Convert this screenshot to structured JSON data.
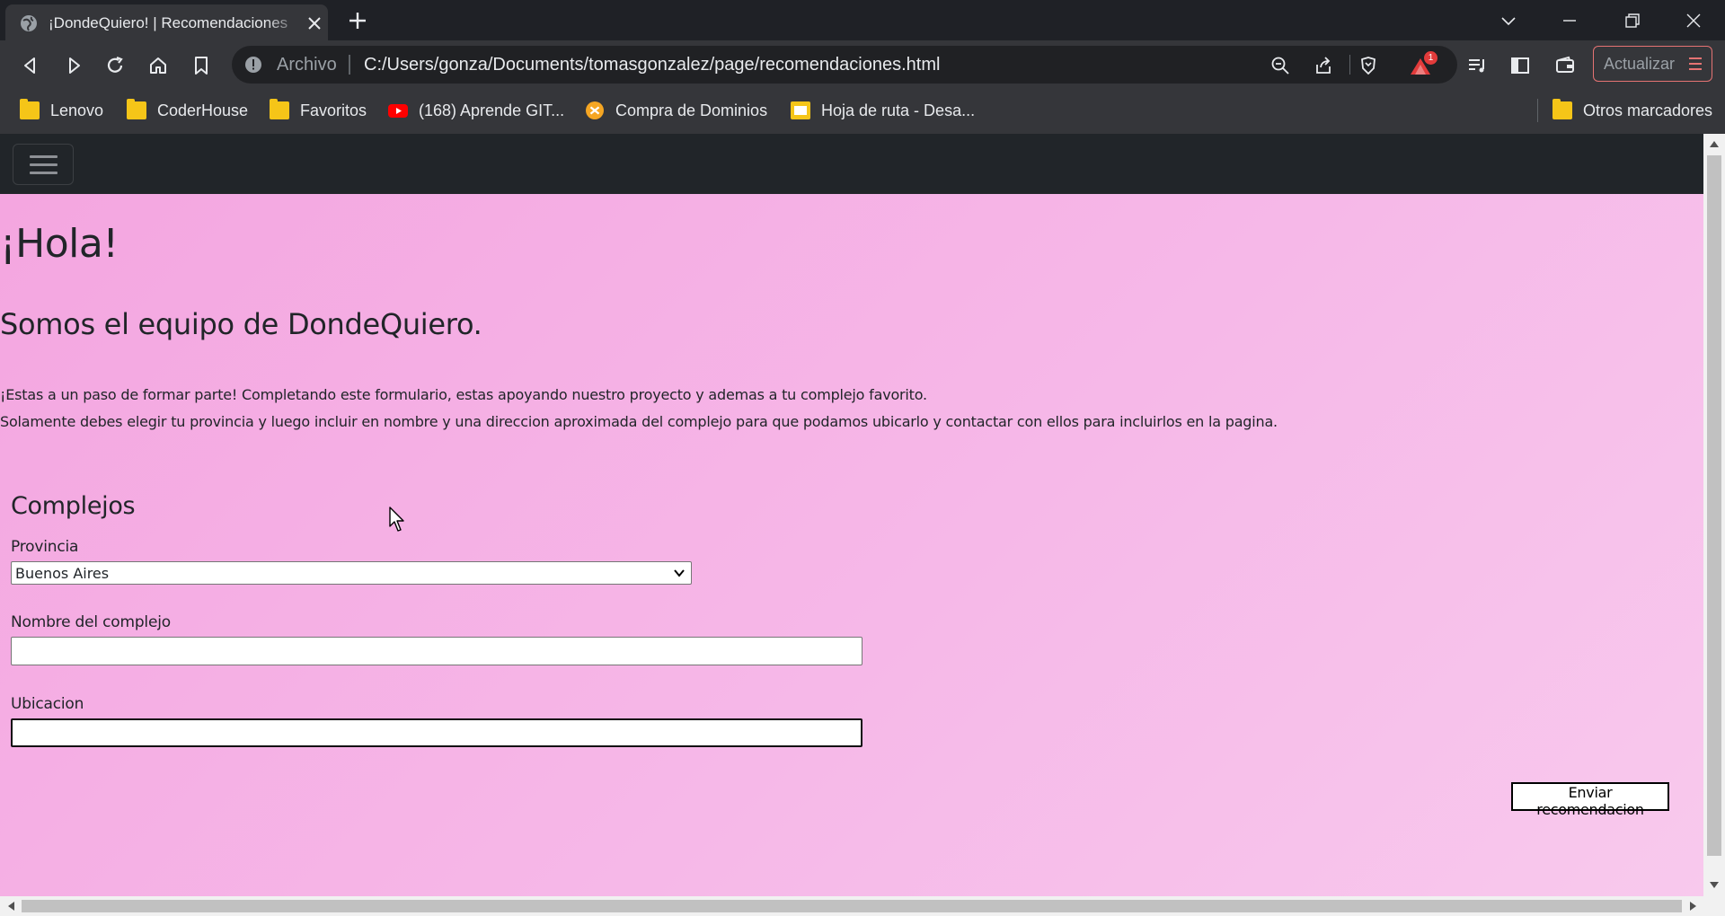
{
  "browser": {
    "tab": {
      "title": "¡DondeQuiero! | Recomendaciones",
      "icon": "globe-icon"
    },
    "address": {
      "scheme_label": "Archivo",
      "url": "C:/Users/gonza/Documents/tomasgonzalez/page/recomendaciones.html"
    },
    "update_button": "Actualizar",
    "rewards_badge": "1",
    "bookmarks": [
      {
        "label": "Lenovo",
        "icon": "folder-icon"
      },
      {
        "label": "CoderHouse",
        "icon": "folder-icon"
      },
      {
        "label": "Favoritos",
        "icon": "folder-icon"
      },
      {
        "label": "(168) Aprende GIT...",
        "icon": "youtube-icon"
      },
      {
        "label": "Compra de Dominios",
        "icon": "site-icon"
      },
      {
        "label": "Hoja de ruta - Desa...",
        "icon": "page-icon"
      }
    ],
    "other_bookmarks": "Otros marcadores"
  },
  "page": {
    "heading": "¡Hola!",
    "subheading": "Somos el equipo de DondeQuiero.",
    "intro_line1": "¡Estas a un paso de formar parte! Completando este formulario, estas apoyando nuestro proyecto y ademas a tu complejo favorito.",
    "intro_line2": "Solamente debes elegir tu provincia y luego incluir en nombre y una direccion aproximada del complejo para que podamos ubicarlo y contactar con ellos para incluirlos en la pagina.",
    "form": {
      "title": "Complejos",
      "province_label": "Provincia",
      "province_value": "Buenos Aires",
      "name_label": "Nombre del complejo",
      "name_value": "",
      "location_label": "Ubicacion",
      "location_value": "",
      "submit_label": "Enviar recomendacion"
    }
  },
  "colors": {
    "page_background": "#f6b8e8",
    "navbar": "#212529",
    "browser_chrome": "#35363a"
  }
}
